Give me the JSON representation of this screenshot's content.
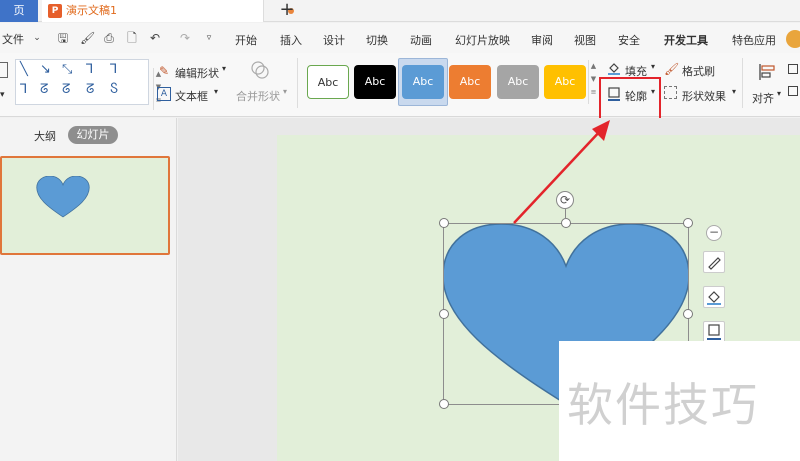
{
  "titlebar": {
    "home_tab": "页",
    "doc_tab": "演示文稿1",
    "add_tab": "+",
    "logo_letter": "P"
  },
  "menubar": {
    "file": "文件",
    "items": [
      "开始",
      "插入",
      "设计",
      "切换",
      "动画",
      "幻灯片放映",
      "审阅",
      "视图",
      "安全",
      "开发工具",
      "特色应用"
    ]
  },
  "ribbon": {
    "edit_shape": "编辑形状",
    "text_box": "文本框",
    "merge_shape": "合并形状",
    "style_label": "Abc",
    "fill": "填充",
    "outline": "轮廓",
    "format_painter": "格式刷",
    "shape_effects": "形状效果",
    "align": "对齐"
  },
  "left_pane": {
    "outline_tab": "大纲",
    "slides_tab": "幻灯片"
  },
  "watermark": "软件技巧",
  "colors": {
    "accent": "#3f73c8",
    "slide_bg": "#e2efd9",
    "heart": "#5b9bd5",
    "highlight": "#e3242b"
  }
}
